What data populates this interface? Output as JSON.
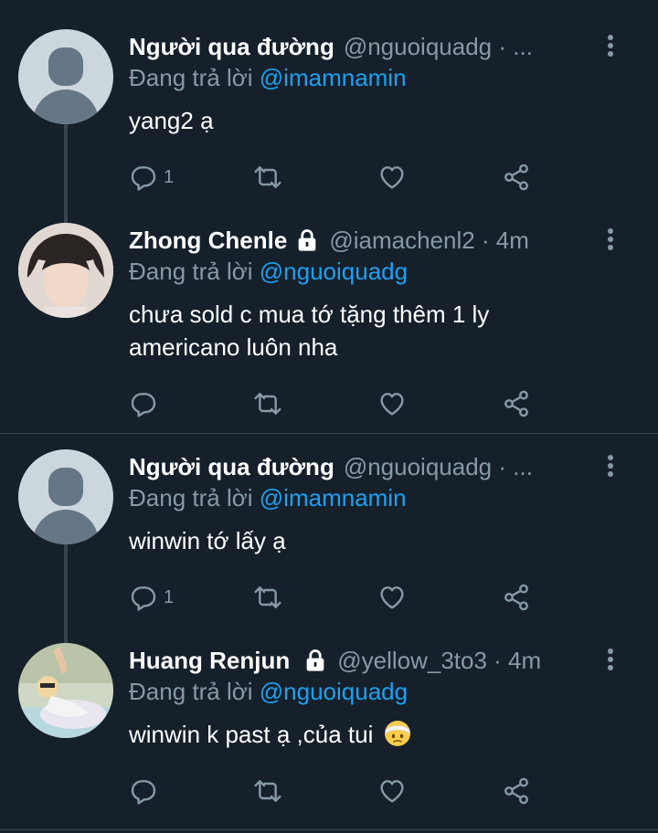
{
  "tweets": [
    {
      "name": "Người qua đường",
      "handle": "@nguoiquadg · ...",
      "replying_prefix": "Đang trả lời ",
      "replying_to": "@imamnamin",
      "text": "yang2 ạ",
      "reply_count": "1",
      "locked": false,
      "avatar": "default"
    },
    {
      "name": "Zhong Chenle",
      "handle": "@iamachenl2 · 4m",
      "replying_prefix": "Đang trả lời ",
      "replying_to": "@nguoiquadg",
      "text": "chưa sold c mua tớ tặng thêm 1 ly americano luôn nha",
      "reply_count": "",
      "locked": true,
      "avatar": "photo"
    },
    {
      "name": "Người qua đường",
      "handle": "@nguoiquadg · ...",
      "replying_prefix": "Đang trả lời ",
      "replying_to": "@imamnamin",
      "text": "winwin tớ lấy ạ",
      "reply_count": "1",
      "locked": false,
      "avatar": "default"
    },
    {
      "name": "Huang Renjun",
      "handle": "@yellow_3to3 · 4m",
      "replying_prefix": "Đang trả lời ",
      "replying_to": "@nguoiquadg",
      "text": "winwin k past ạ ,của tui",
      "reply_count": "",
      "locked": true,
      "avatar": "photo",
      "emoji": "face-with-head-bandage-emoji"
    }
  ],
  "icons": {
    "reply": "reply-icon",
    "retweet": "retweet-icon",
    "like": "heart-icon",
    "share": "share-icon",
    "lock": "lock-icon",
    "menu": "more-vertical-icon"
  },
  "colors": {
    "background": "#15202b",
    "secondary_text": "#8899a6",
    "link": "#1da1f2",
    "divider": "#38444d"
  }
}
